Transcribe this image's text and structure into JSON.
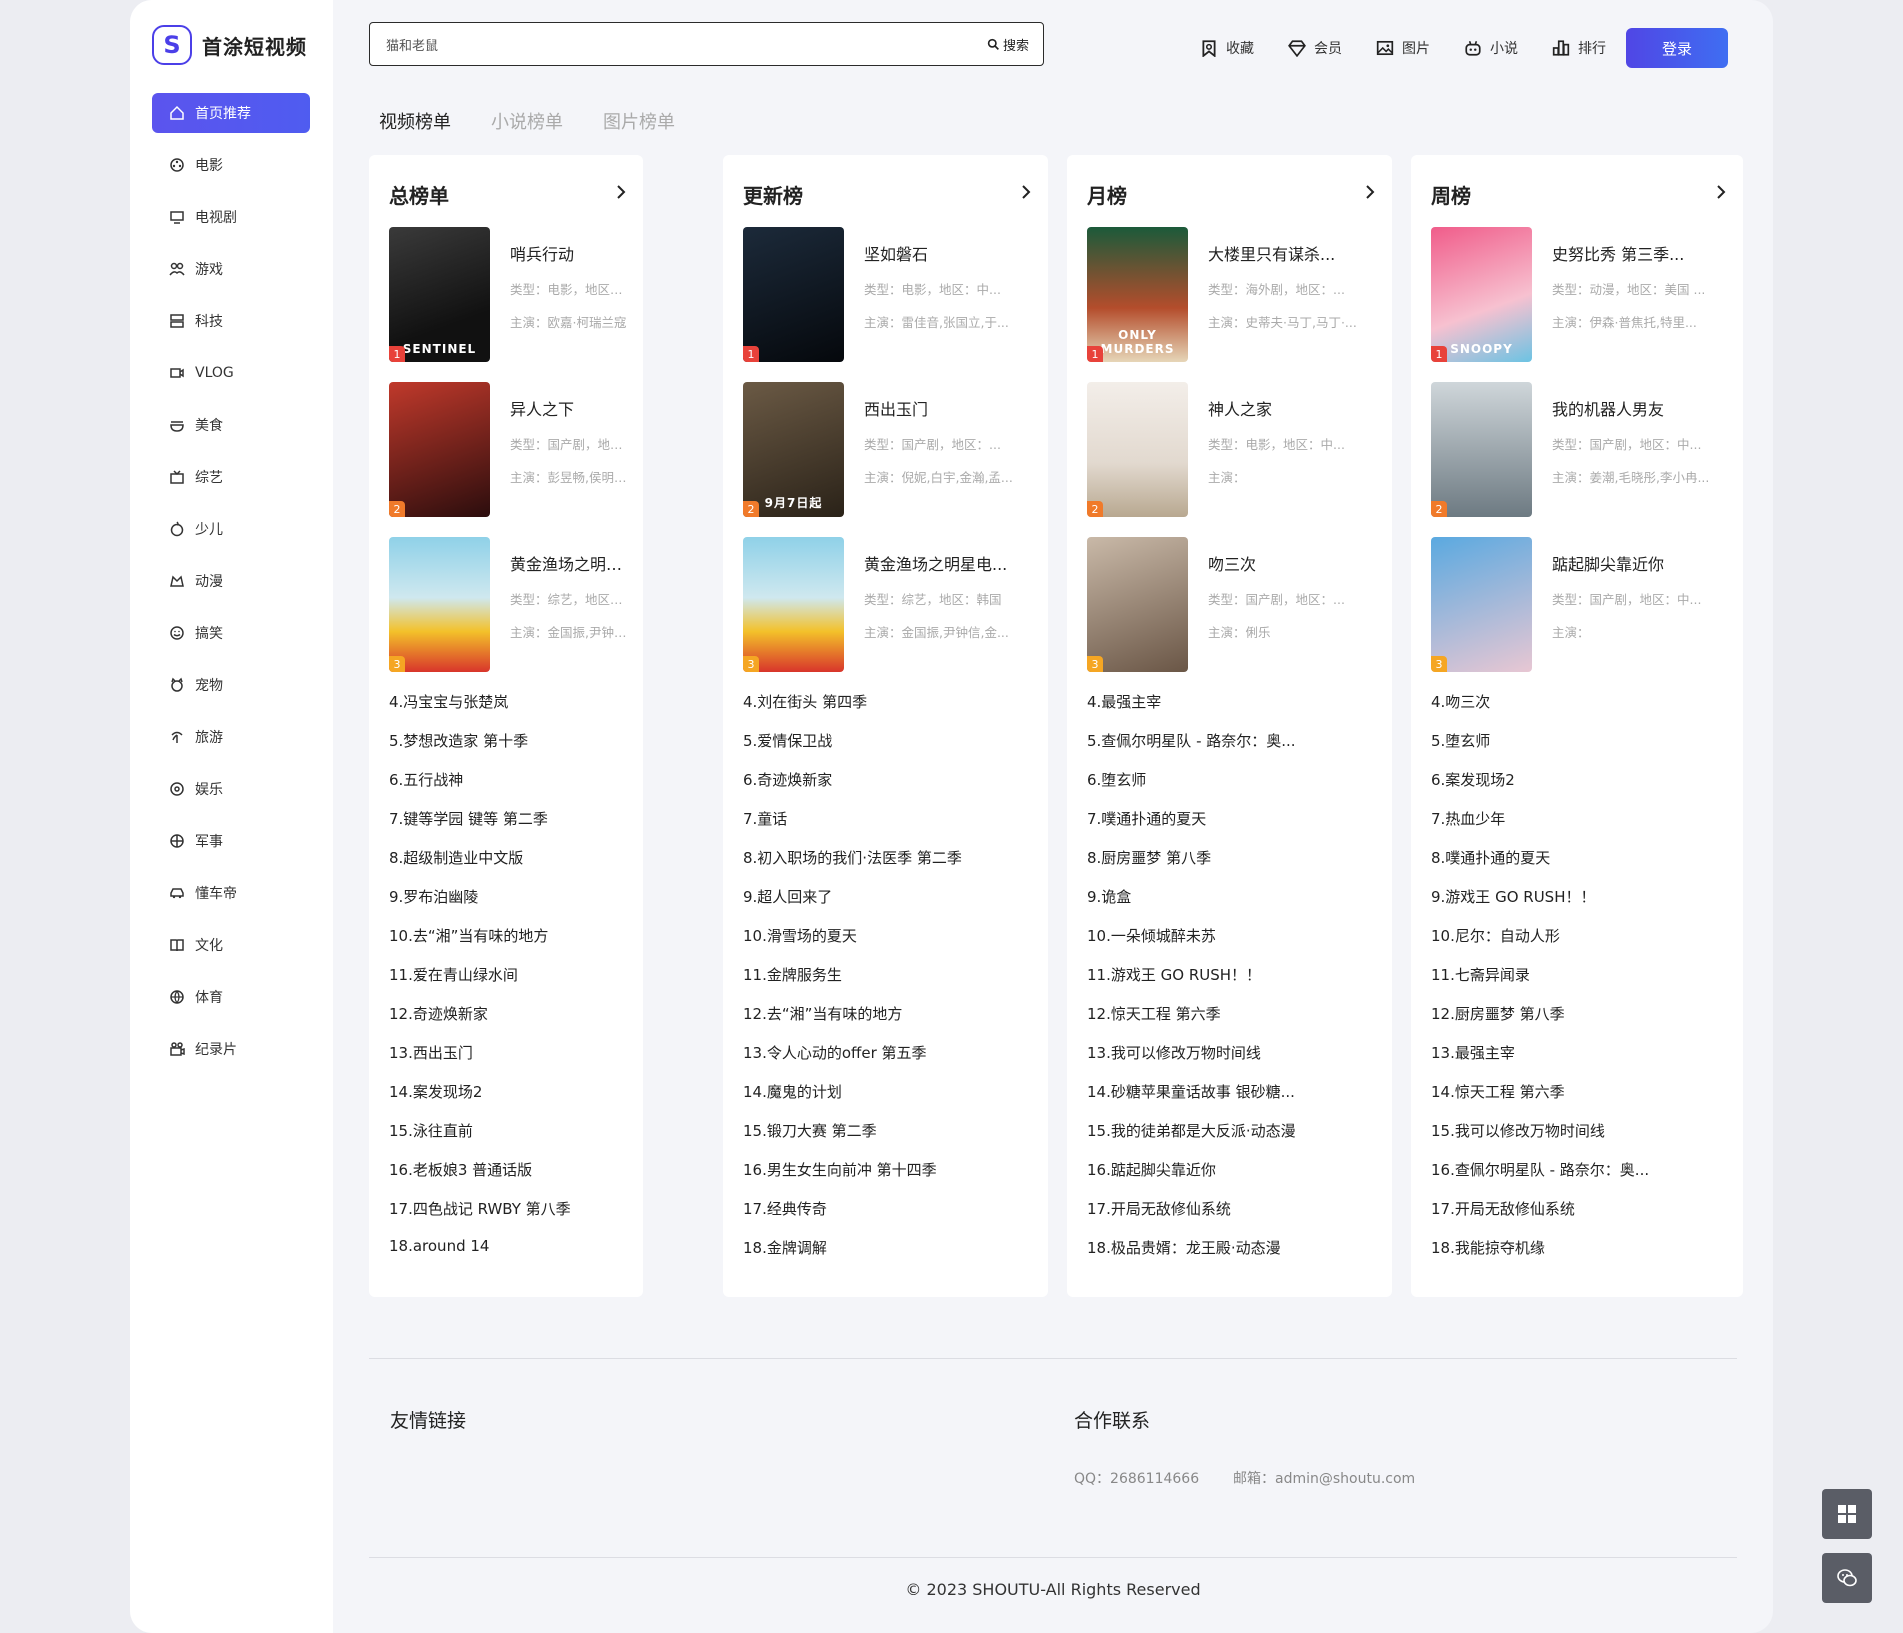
{
  "brand": {
    "name": "首涂短视频",
    "logo_letter": "S",
    "accent": "#4b3fe8"
  },
  "sidebar": {
    "items": [
      {
        "label": "首页推荐",
        "icon": "home-icon"
      },
      {
        "label": "电影",
        "icon": "film-reel-icon"
      },
      {
        "label": "电视剧",
        "icon": "tv-icon"
      },
      {
        "label": "游戏",
        "icon": "gamepad-icon"
      },
      {
        "label": "科技",
        "icon": "server-icon"
      },
      {
        "label": "VLOG",
        "icon": "video-camera-icon"
      },
      {
        "label": "美食",
        "icon": "food-bowl-icon"
      },
      {
        "label": "综艺",
        "icon": "variety-box-icon"
      },
      {
        "label": "少儿",
        "icon": "kids-icon"
      },
      {
        "label": "动漫",
        "icon": "anime-icon"
      },
      {
        "label": "搞笑",
        "icon": "smile-icon"
      },
      {
        "label": "宠物",
        "icon": "pet-icon"
      },
      {
        "label": "旅游",
        "icon": "palm-tree-icon"
      },
      {
        "label": "娱乐",
        "icon": "music-disc-icon"
      },
      {
        "label": "军事",
        "icon": "target-icon"
      },
      {
        "label": "懂车帝",
        "icon": "car-icon"
      },
      {
        "label": "文化",
        "icon": "book-icon"
      },
      {
        "label": "体育",
        "icon": "ball-icon"
      },
      {
        "label": "纪录片",
        "icon": "documentary-icon"
      }
    ]
  },
  "search": {
    "value": "猫和老鼠",
    "button_label": "搜索"
  },
  "topnav": {
    "items": [
      {
        "label": "收藏",
        "icon": "bookmark-icon"
      },
      {
        "label": "会员",
        "icon": "diamond-icon"
      },
      {
        "label": "图片",
        "icon": "image-icon"
      },
      {
        "label": "小说",
        "icon": "robot-icon"
      },
      {
        "label": "排行",
        "icon": "bar-chart-icon"
      }
    ],
    "login_label": "登录"
  },
  "tabs": [
    {
      "label": "视频榜单",
      "active": true
    },
    {
      "label": "小说榜单",
      "active": false
    },
    {
      "label": "图片榜单",
      "active": false
    }
  ],
  "boards": [
    {
      "title": "总榜单",
      "top": [
        {
          "rank": "1",
          "title": "哨兵行动",
          "meta": "类型：电影，地区：法国",
          "cast": "主演：欧嘉·柯瑞兰寇",
          "caption": "SENTINEL"
        },
        {
          "rank": "2",
          "title": "异人之下",
          "meta": "类型：国产剧，地区：中...",
          "cast": "主演：彭昱畅,侯明昊,王影...",
          "caption": ""
        },
        {
          "rank": "3",
          "title": "黄金渔场之明星电...",
          "meta": "类型：综艺，地区：韩国",
          "cast": "主演：金国振,尹钟信,金九...",
          "caption": ""
        }
      ],
      "list": [
        "4.冯宝宝与张楚岚",
        "5.梦想改造家 第十季",
        "6.五行战神",
        "7.键等学园 键等 第二季",
        "8.超级制造业中文版",
        "9.罗布泊幽陵",
        "10.去“湘”当有味的地方",
        "11.爱在青山绿水间",
        "12.奇迹焕新家",
        "13.西出玉门",
        "14.案发现场2",
        "15.泳往直前",
        "16.老板娘3 普通话版",
        "17.四色战记 RWBY 第八季",
        "18.around 14"
      ]
    },
    {
      "title": "更新榜",
      "top": [
        {
          "rank": "1",
          "title": "坚如磐石",
          "meta": "类型：电影，地区：中...",
          "cast": "主演：雷佳音,张国立,于...",
          "caption": ""
        },
        {
          "rank": "2",
          "title": "西出玉门",
          "meta": "类型：国产剧，地区：...",
          "cast": "主演：倪妮,白宇,金瀚,孟...",
          "caption": "9月7日起"
        },
        {
          "rank": "3",
          "title": "黄金渔场之明星电...",
          "meta": "类型：综艺，地区：韩国",
          "cast": "主演：金国振,尹钟信,金...",
          "caption": ""
        }
      ],
      "list": [
        "4.刘在街头 第四季",
        "5.爱情保卫战",
        "6.奇迹焕新家",
        "7.童话",
        "8.初入职场的我们·法医季 第二季",
        "9.超人回来了",
        "10.滑雪场的夏天",
        "11.金牌服务生",
        "12.去“湘”当有味的地方",
        "13.令人心动的offer 第五季",
        "14.魔鬼的计划",
        "15.锻刀大赛 第二季",
        "16.男生女生向前冲 第十四季",
        "17.经典传奇",
        "18.金牌调解"
      ]
    },
    {
      "title": "月榜",
      "top": [
        {
          "rank": "1",
          "title": "大楼里只有谋杀...",
          "meta": "类型：海外剧，地区：...",
          "cast": "主演：史蒂夫·马丁,马丁·...",
          "caption": "ONLY MURDERS"
        },
        {
          "rank": "2",
          "title": "神人之家",
          "meta": "类型：电影，地区：中...",
          "cast": "主演：",
          "caption": ""
        },
        {
          "rank": "3",
          "title": "吻三次",
          "meta": "类型：国产剧，地区：...",
          "cast": "主演：俐乐",
          "caption": ""
        }
      ],
      "list": [
        "4.最强主宰",
        "5.查佩尔明星队 - 路奈尔：奥...",
        "6.堕玄师",
        "7.噗通扑通的夏天",
        "8.厨房噩梦 第八季",
        "9.诡盒",
        "10.一朵倾城醉未苏",
        "11.游戏王 GO RUSH！！",
        "12.惊天工程 第六季",
        "13.我可以修改万物时间线",
        "14.砂糖苹果童话故事 银砂糖...",
        "15.我的徒弟都是大反派·动态漫",
        "16.踮起脚尖靠近你",
        "17.开局无敌修仙系统",
        "18.极品贵婿：龙王殿·动态漫"
      ]
    },
    {
      "title": "周榜",
      "top": [
        {
          "rank": "1",
          "title": "史努比秀 第三季...",
          "meta": "类型：动漫，地区：美国 ...",
          "cast": "主演：伊森·普焦托,特里...",
          "caption": "SNOOPY"
        },
        {
          "rank": "2",
          "title": "我的机器人男友",
          "meta": "类型：国产剧，地区：中...",
          "cast": "主演：姜潮,毛晓彤,李小冉...",
          "caption": ""
        },
        {
          "rank": "3",
          "title": "踮起脚尖靠近你",
          "meta": "类型：国产剧，地区：中...",
          "cast": "主演：",
          "caption": ""
        }
      ],
      "list": [
        "4.吻三次",
        "5.堕玄师",
        "6.案发现场2",
        "7.热血少年",
        "8.噗通扑通的夏天",
        "9.游戏王 GO RUSH！！",
        "10.尼尔：自动人形",
        "11.七斋异闻录",
        "12.厨房噩梦 第八季",
        "13.最强主宰",
        "14.惊天工程 第六季",
        "15.我可以修改万物时间线",
        "16.查佩尔明星队 - 路奈尔：奥...",
        "17.开局无敌修仙系统",
        "18.我能掠夺机缘"
      ]
    }
  ],
  "footer": {
    "links_title": "友情链接",
    "contact_title": "合作联系",
    "qq": "QQ：2686114666",
    "email": "邮箱：admin@shoutu.com",
    "copyright": "© 2023 SHOUTU-All Rights Reserved"
  },
  "float_buttons": [
    {
      "icon": "windows-icon"
    },
    {
      "icon": "wechat-icon"
    }
  ],
  "rank_colors": [
    "#e8423a",
    "#f07a2a",
    "#f5a623"
  ]
}
